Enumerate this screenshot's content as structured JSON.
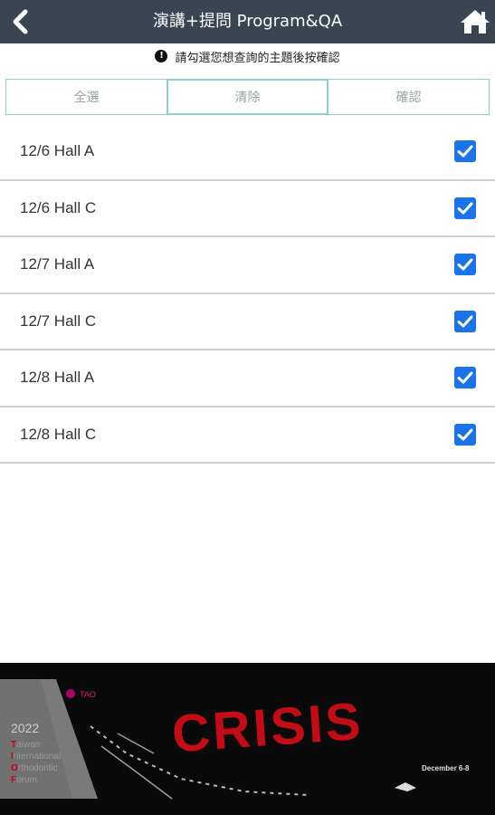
{
  "header": {
    "title": "演講+提問 Program&QA",
    "back_icon": "chevron-left-icon",
    "home_icon": "home-icon"
  },
  "hint": {
    "icon": "info-icon",
    "text": "請勾選您想查詢的主題後按確認"
  },
  "actions": {
    "select_all": "全選",
    "clear": "清除",
    "confirm": "確認"
  },
  "sessions": [
    {
      "label": "12/6 Hall A",
      "checked": true
    },
    {
      "label": "12/6 Hall C",
      "checked": true
    },
    {
      "label": "12/7 Hall A",
      "checked": true
    },
    {
      "label": "12/7 Hall C",
      "checked": true
    },
    {
      "label": "12/8 Hall A",
      "checked": true
    },
    {
      "label": "12/8 Hall C",
      "checked": true
    }
  ],
  "banner": {
    "year": "2022",
    "lines": [
      {
        "initial": "T",
        "rest": "aiwan"
      },
      {
        "initial": "I",
        "rest": "nternational"
      },
      {
        "initial": "O",
        "rest": "rthodontic"
      },
      {
        "initial": "F",
        "rest": "orum"
      }
    ],
    "headline": "CRISIS",
    "date": "December 6-8"
  },
  "colors": {
    "topbar": "#3a4552",
    "checkbox": "#1a73e8",
    "button_border": "#8fd0cc",
    "crisis_red": "#c40c16"
  }
}
